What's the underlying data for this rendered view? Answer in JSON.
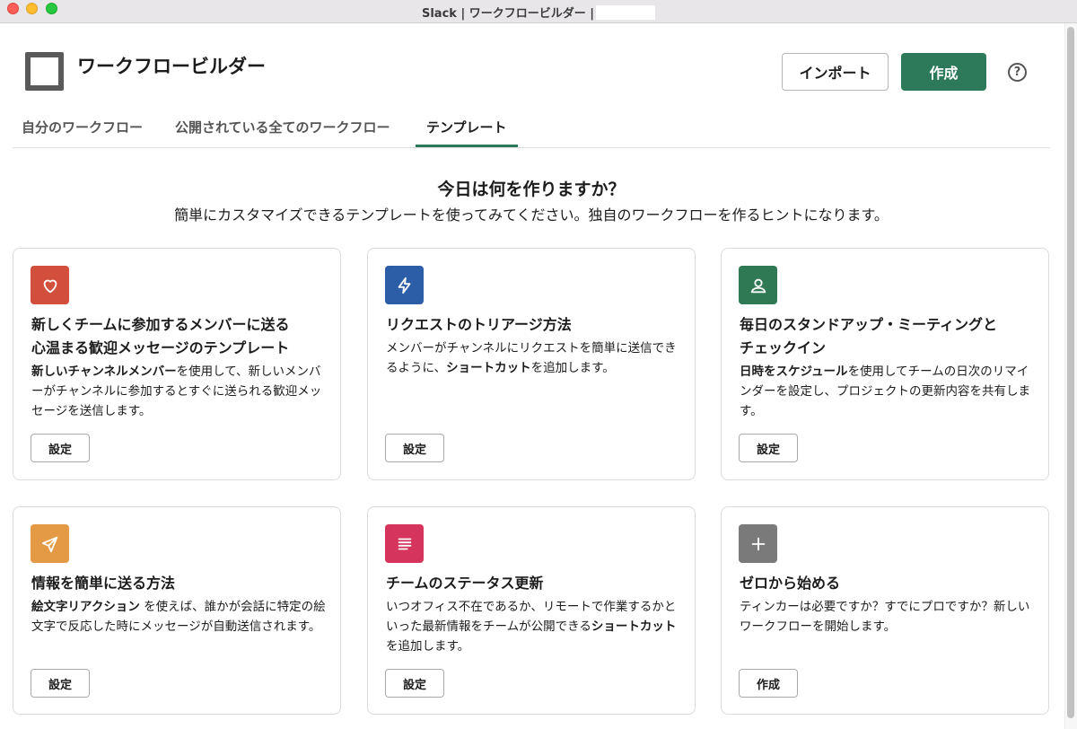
{
  "window": {
    "title": "Slack | ワークフロービルダー |"
  },
  "header": {
    "title": "ワークフロービルダー",
    "import_label": "インポート",
    "create_label": "作成",
    "help_glyph": "?"
  },
  "tabs": [
    {
      "label": "自分のワークフロー",
      "active": false
    },
    {
      "label": "公開されている全てのワークフロー",
      "active": false
    },
    {
      "label": "テンプレート",
      "active": true
    }
  ],
  "hero": {
    "title": "今日は何を作りますか？",
    "subtitle": "簡単にカスタマイズできるテンプレートを使ってみてください。独自のワークフローを作るヒントになります。"
  },
  "cards": [
    {
      "icon": "heart-icon",
      "icon_color": "#d2503b",
      "title_line1": "新しくチームに参加するメンバーに送る",
      "title_line2": "心温まる歓迎メッセージのテンプレート",
      "desc_bold": "新しいチャンネルメンバー",
      "desc_rest": "を使用して、新しいメンバーがチャンネルに参加するとすぐに送られる歓迎メッセージを送信します。",
      "button": "設定"
    },
    {
      "icon": "lightning-icon",
      "icon_color": "#2c5ea8",
      "title_line1": "リクエストのトリアージ方法",
      "desc_pre": "メンバーがチャンネルにリクエストを簡単に送信できるように、",
      "desc_bold": "ショートカット",
      "desc_rest": "を追加します。",
      "button": "設定"
    },
    {
      "icon": "person-icon",
      "icon_color": "#2f7a54",
      "title_line1": "毎日のスタンドアップ・ミーティングと",
      "title_line2": "チェックイン",
      "desc_bold": "日時をスケジュール",
      "desc_rest": "を使用してチームの日次のリマインダーを設定し、プロジェクトの更新内容を共有します。",
      "button": "設定"
    },
    {
      "icon": "paper-plane-icon",
      "icon_color": "#e49a45",
      "title_line1": "情報を簡単に送る方法",
      "desc_bold": "絵文字リアクション",
      "desc_rest": " を使えば、誰かが会話に特定の絵文字で反応した時にメッセージが自動送信されます。",
      "button": "設定"
    },
    {
      "icon": "lines-icon",
      "icon_color": "#d5355d",
      "title_line1": "チームのステータス更新",
      "desc_pre": "いつオフィス不在であるか、リモートで作業するかといった最新情報をチームが公開できる",
      "desc_bold": "ショートカット",
      "desc_rest": "を追加します。",
      "button": "設定"
    },
    {
      "icon": "plus-icon",
      "icon_color": "#7a7a7a",
      "title_line1": "ゼロから始める",
      "desc_rest": "ティンカーは必要ですか？すでにプロですか？新しいワークフローを開始します。",
      "button": "作成"
    }
  ]
}
